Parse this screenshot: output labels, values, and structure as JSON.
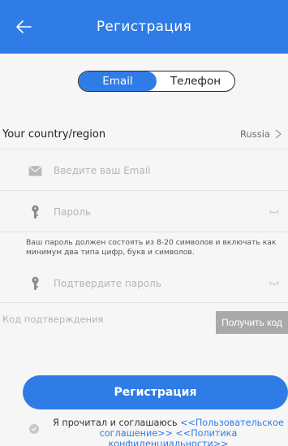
{
  "header": {
    "title": "Регистрация"
  },
  "tabs": [
    {
      "label": "Email",
      "active": true
    },
    {
      "label": "Телефон",
      "active": false
    }
  ],
  "country": {
    "label": "Your country/region",
    "value": "Russia"
  },
  "fields": {
    "email_placeholder": "Введите ваш Email",
    "password_placeholder": "Пароль",
    "password_hint": "Ваш пароль должен состоять из 8-20 символов и включать как минимум два типа цифр, букв и символов.",
    "confirm_placeholder": "Подтвердите пароль",
    "code_label": "Код подтверждения",
    "get_code_label": "Получить код"
  },
  "submit_label": "Регистрация",
  "agreement": {
    "prefix": "Я прочитал и соглашаюсь",
    "user_agreement": "<<Пользовательское соглашение>>",
    "privacy_policy": "<<Политика конфиденциальности>>"
  },
  "colors": {
    "primary": "#2f7ce6",
    "code_button": "#a9a9a9",
    "background": "#f6f6f6"
  }
}
